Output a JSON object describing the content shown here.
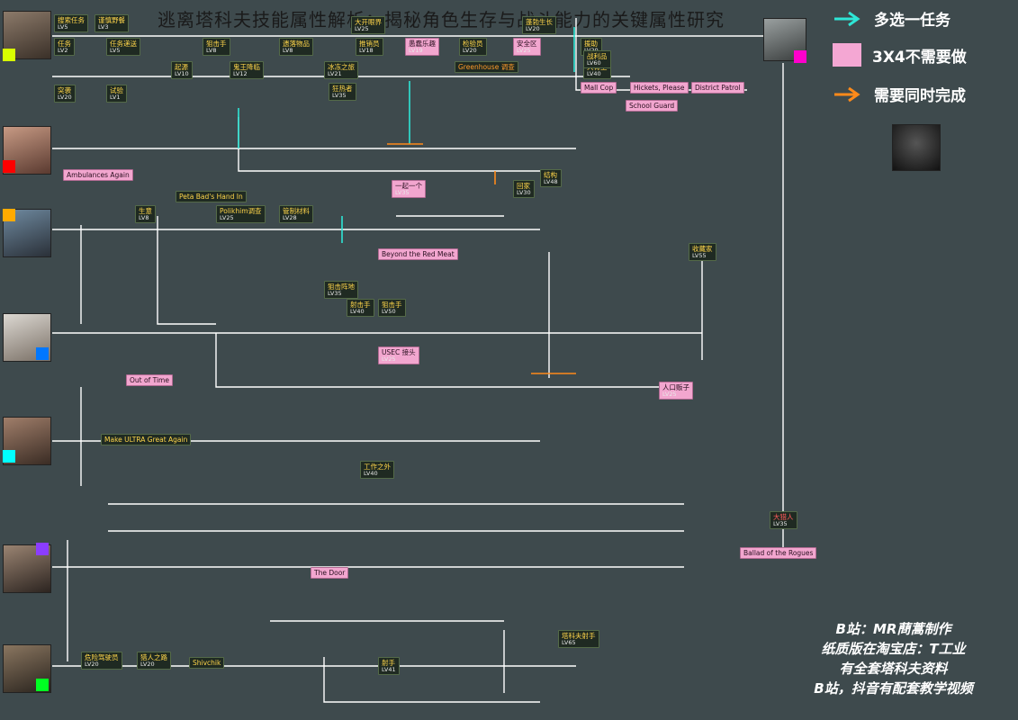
{
  "title": "逃离塔科夫技能属性解析：揭秘角色生存与战斗能力的关键属性研究",
  "legend": {
    "items": [
      {
        "text": "多选一任务",
        "kind": "teal-arrow"
      },
      {
        "text": "3X4不需要做",
        "kind": "pink-box"
      },
      {
        "text": "需要同时完成",
        "kind": "orange-arrow"
      }
    ]
  },
  "credits": [
    "B站：MR蔄蒿制作",
    "纸质版在淘宝店：T工业",
    "有全套塔科夫资料",
    "B站，抖音有配套教学视频"
  ],
  "colors": {
    "background": "#3e4a4d",
    "node_text": "#ffd54a",
    "pink": "#f2a6cf",
    "line": "#ffffff",
    "teal": "#2ee6d6",
    "orange": "#ff8a1a"
  },
  "traders": [
    {
      "name": "prapor",
      "chip": "#d8ff00"
    },
    {
      "name": "therapist",
      "chip": "#ff0000"
    },
    {
      "name": "skier",
      "chip": "#ffaa00"
    },
    {
      "name": "peacekeeper",
      "chip": "#0077ff"
    },
    {
      "name": "mechanic",
      "chip": "#00ffff"
    },
    {
      "name": "ragman",
      "chip": "#8b3dff"
    },
    {
      "name": "jaeger",
      "chip": "#00ff22"
    },
    {
      "name": "fence",
      "chip": "#ff00cc"
    }
  ],
  "nodes": [
    {
      "t": "搜索任务",
      "lv": "LV5"
    },
    {
      "t": "谨慎野餐",
      "lv": "LV3"
    },
    {
      "t": "任务",
      "lv": "LV2"
    },
    {
      "t": "任务递送",
      "lv": "LV5"
    },
    {
      "t": "狙击手",
      "lv": "LV8"
    },
    {
      "t": "遗落物品",
      "lv": "LV8"
    },
    {
      "t": "推销员",
      "lv": "LV18"
    },
    {
      "t": "愚蠢乐趣",
      "lv": "LV19"
    },
    {
      "t": "检验员",
      "lv": "LV20"
    },
    {
      "t": "安全区",
      "lv": "LV25"
    },
    {
      "t": "大开眼界",
      "lv": "LV25"
    },
    {
      "t": "蓬勃生长",
      "lv": "LV20"
    },
    {
      "t": "援助",
      "lv": "LV20"
    },
    {
      "t": "起源",
      "lv": "LV10"
    },
    {
      "t": "鬼王降临",
      "lv": "LV12"
    },
    {
      "t": "冰冻之旅",
      "lv": "LV21"
    },
    {
      "t": "狂热者",
      "lv": "LV35"
    },
    {
      "t": "大胃王",
      "lv": "LV40"
    },
    {
      "t": "战利品",
      "lv": "LV60"
    },
    {
      "t": "Mall Cop",
      "lv": ""
    },
    {
      "t": "Hickets, Please",
      "lv": ""
    },
    {
      "t": "District Patrol",
      "lv": ""
    },
    {
      "t": "School Guard",
      "lv": ""
    },
    {
      "t": "Greenhouse 调查",
      "lv": ""
    },
    {
      "t": "突袭",
      "lv": "LV20"
    },
    {
      "t": "试验",
      "lv": "LV1"
    },
    {
      "t": "Ambulances Again",
      "lv": ""
    },
    {
      "t": "Peta Bad's Hand In",
      "lv": ""
    },
    {
      "t": "一起一个",
      "lv": "LV35"
    },
    {
      "t": "回家",
      "lv": "LV30"
    },
    {
      "t": "结构",
      "lv": "LV48"
    },
    {
      "t": "生意",
      "lv": "LV8"
    },
    {
      "t": "Polikhim调查",
      "lv": "LV25"
    },
    {
      "t": "管制材料",
      "lv": "LV28"
    },
    {
      "t": "Beyond the Red Meat",
      "lv": ""
    },
    {
      "t": "狙击阵地",
      "lv": "LV35"
    },
    {
      "t": "射击手",
      "lv": "LV40"
    },
    {
      "t": "狙击手",
      "lv": "LV50"
    },
    {
      "t": "Out of Time",
      "lv": ""
    },
    {
      "t": "Make ULTRA Great Again",
      "lv": ""
    },
    {
      "t": "The Door",
      "lv": ""
    },
    {
      "t": "USEC 接头",
      "lv": "LV25"
    },
    {
      "t": "人口贩子",
      "lv": "LV25"
    },
    {
      "t": "工作之外",
      "lv": "LV40"
    },
    {
      "t": "猎人之路",
      "lv": "LV20"
    },
    {
      "t": "危险驾驶员",
      "lv": "LV20"
    },
    {
      "t": "射手",
      "lv": "LV41"
    },
    {
      "t": "Shivchik",
      "lv": ""
    },
    {
      "t": "塔科夫射手",
      "lv": "LV65"
    },
    {
      "t": "Ballad of the Rogues",
      "lv": ""
    },
    {
      "t": "大猎人",
      "lv": "LV35"
    },
    {
      "t": "收藏家",
      "lv": "LV55"
    }
  ]
}
